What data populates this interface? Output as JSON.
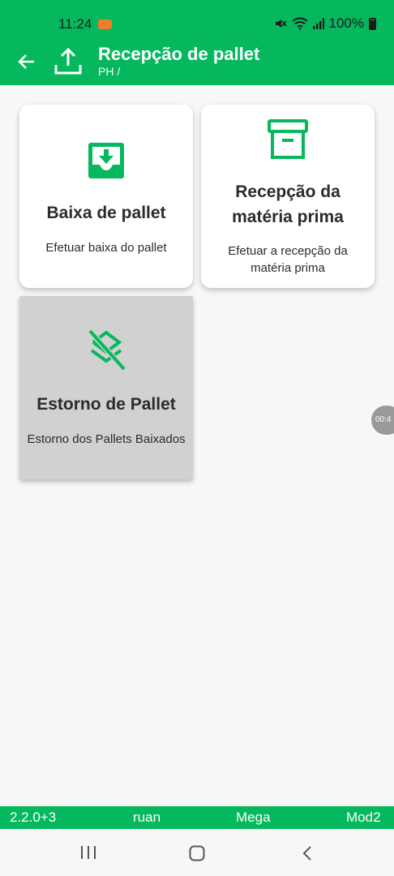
{
  "status_bar": {
    "time": "11:24",
    "battery": "100%",
    "icons": [
      "recording-icon",
      "mute-icon",
      "wifi-icon",
      "signal-icon",
      "battery-icon"
    ]
  },
  "app_bar": {
    "title": "Recepção de pallet",
    "subtitle": "PH /",
    "icons": [
      "back-arrow-icon",
      "upload-icon"
    ]
  },
  "cards": [
    {
      "title": "Baixa de pallet",
      "description": "Efetuar baixa do pallet",
      "icon": "download-tray-icon",
      "enabled": true
    },
    {
      "title_line1": "Recepção da",
      "title_line2": "matéria prima",
      "description_line1": "Efetuar a recepção da",
      "description_line2": "matéria prima",
      "icon": "archive-box-icon",
      "enabled": true
    },
    {
      "title": "Estorno de Pallet",
      "description": "Estorno dos Pallets Baixados",
      "icon": "layers-off-icon",
      "enabled": false
    }
  ],
  "side_badge": {
    "text": "00:4"
  },
  "footer": {
    "version": "2.2.0+3",
    "user": "ruan",
    "company": "Mega",
    "module": "Mod2"
  },
  "colors": {
    "primary": "#05b85e",
    "background": "#f7f7f7",
    "card": "#ffffff",
    "card_disabled": "#d1d1d1",
    "text": "#2b2b2b"
  },
  "nav_bar": {
    "icons": [
      "recent-apps-icon",
      "home-icon",
      "back-icon"
    ]
  }
}
